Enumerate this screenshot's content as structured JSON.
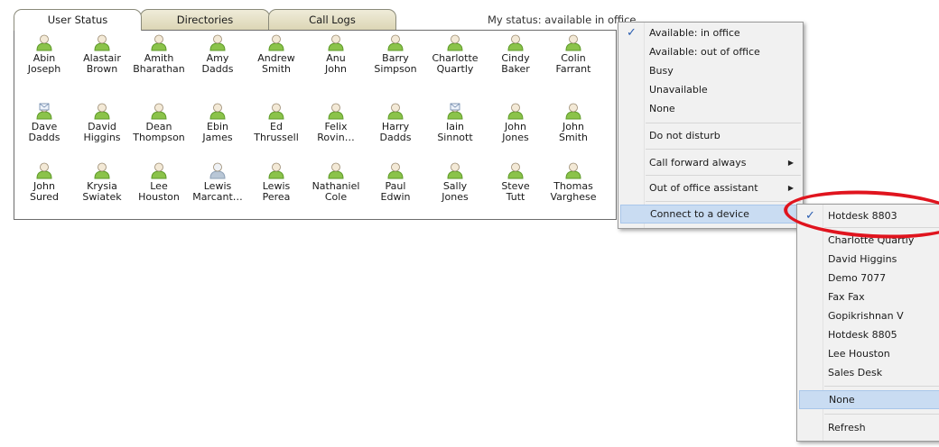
{
  "tabs": [
    {
      "label": "User Status"
    },
    {
      "label": "Directories"
    },
    {
      "label": "Call Logs"
    }
  ],
  "status_text": "My status: available in office",
  "users": [
    {
      "first": "Abin",
      "last": "Joseph",
      "icon": "green-user-icon"
    },
    {
      "first": "Alastair",
      "last": "Brown",
      "icon": "green-user-icon"
    },
    {
      "first": "Amith",
      "last": "Bharathan",
      "icon": "green-user-icon"
    },
    {
      "first": "Amy",
      "last": "Dadds",
      "icon": "green-user-icon"
    },
    {
      "first": "Andrew",
      "last": "Smith",
      "icon": "green-user-icon"
    },
    {
      "first": "Anu",
      "last": "John",
      "icon": "green-user-icon"
    },
    {
      "first": "Barry",
      "last": "Simpson",
      "icon": "green-user-icon"
    },
    {
      "first": "Charlotte",
      "last": "Quartly",
      "icon": "green-user-icon"
    },
    {
      "first": "Cindy",
      "last": "Baker",
      "icon": "green-user-icon"
    },
    {
      "first": "Colin",
      "last": "Farrant",
      "icon": "green-user-icon"
    },
    {
      "first": "Dave",
      "last": "Dadds",
      "icon": "green-user-mail-icon"
    },
    {
      "first": "David",
      "last": "Higgins",
      "icon": "green-user-icon"
    },
    {
      "first": "Dean",
      "last": "Thompson",
      "icon": "green-user-icon"
    },
    {
      "first": "Ebin",
      "last": "James",
      "icon": "green-user-icon"
    },
    {
      "first": "Ed",
      "last": "Thrussell",
      "icon": "green-user-icon"
    },
    {
      "first": "Felix",
      "last": "Rovin…",
      "icon": "green-user-icon"
    },
    {
      "first": "Harry",
      "last": "Dadds",
      "icon": "green-user-icon"
    },
    {
      "first": "Iain",
      "last": "Sinnott",
      "icon": "green-user-mail-icon"
    },
    {
      "first": "John",
      "last": "Jones",
      "icon": "green-user-icon"
    },
    {
      "first": "John",
      "last": "Smith",
      "icon": "green-user-icon"
    },
    {
      "first": "John",
      "last": "Sured",
      "icon": "green-user-icon"
    },
    {
      "first": "Krysia",
      "last": "Swiatek",
      "icon": "green-user-icon"
    },
    {
      "first": "Lee",
      "last": "Houston",
      "icon": "green-user-icon"
    },
    {
      "first": "Lewis",
      "last": "Marcant…",
      "icon": "grey-user-icon"
    },
    {
      "first": "Lewis",
      "last": "Perea",
      "icon": "green-user-icon"
    },
    {
      "first": "Nathaniel",
      "last": "Cole",
      "icon": "green-user-icon"
    },
    {
      "first": "Paul",
      "last": "Edwin",
      "icon": "green-user-icon"
    },
    {
      "first": "Sally",
      "last": "Jones",
      "icon": "green-user-icon"
    },
    {
      "first": "Steve",
      "last": "Tutt",
      "icon": "green-user-icon"
    },
    {
      "first": "Thomas",
      "last": "Varghese",
      "icon": "green-user-icon"
    }
  ],
  "status_menu": {
    "items": [
      {
        "label": "Available: in office",
        "checked": true
      },
      {
        "label": "Available: out of office"
      },
      {
        "label": "Busy"
      },
      {
        "label": "Unavailable"
      },
      {
        "label": "None"
      },
      {
        "label": "Do not disturb"
      },
      {
        "label": "Call forward always",
        "submenu": true
      },
      {
        "label": "Out of office assistant",
        "submenu": true
      },
      {
        "label": "Connect to a device",
        "highlighted": true
      }
    ]
  },
  "device_menu": {
    "items": [
      {
        "label": "Hotdesk 8803",
        "checked": true
      },
      {
        "label": "Charlotte Quartly"
      },
      {
        "label": "David Higgins"
      },
      {
        "label": "Demo 7077"
      },
      {
        "label": "Fax Fax"
      },
      {
        "label": "Gopikrishnan V"
      },
      {
        "label": "Hotdesk 8805"
      },
      {
        "label": "Lee Houston"
      },
      {
        "label": "Sales Desk"
      },
      {
        "label": "None",
        "highlighted": true
      },
      {
        "label": "Refresh"
      }
    ]
  },
  "colors": {
    "accent_check": "#2a5db0",
    "user_green": "#8bc34a",
    "user_grey": "#b9c7d6",
    "annotation_red": "#e0141e",
    "menu_highlight": "#c9dcf2"
  }
}
